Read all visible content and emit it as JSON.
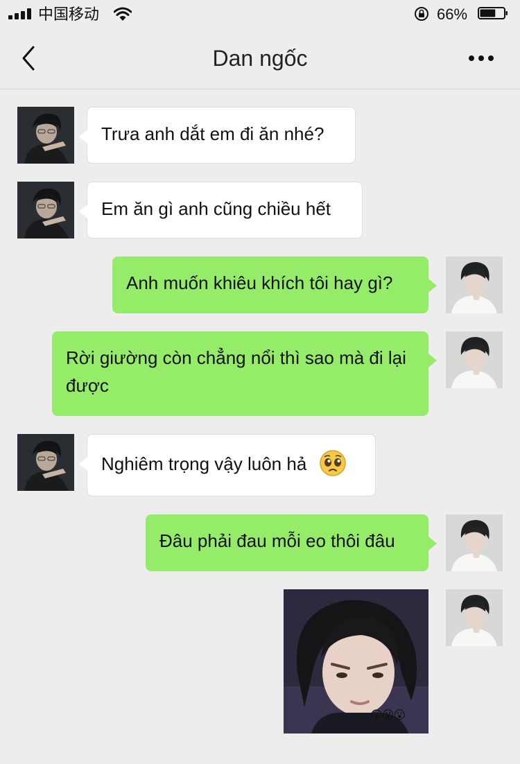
{
  "status_bar": {
    "carrier": "中国移动",
    "battery_percent": "66%",
    "battery_level": 0.66
  },
  "header": {
    "title": "Dan ngốc"
  },
  "messages": [
    {
      "from": "them",
      "text": "Trưa anh dắt em đi ăn nhé?"
    },
    {
      "from": "them",
      "text": "Em ăn gì anh cũng chiều hết"
    },
    {
      "from": "me",
      "text": "Anh muốn khiêu khích tôi hay gì?"
    },
    {
      "from": "me",
      "text": "Rời giường còn chẳng nổi thì sao mà đi lại được"
    },
    {
      "from": "them",
      "text": "Nghiêm trọng vậy luôn hả",
      "emoji": "pleading-face"
    },
    {
      "from": "me",
      "text": "Đâu phải đau mỗi eo thôi đâu"
    },
    {
      "from": "me",
      "type": "image",
      "emoji_overlay": [
        "😮",
        "😮",
        "😮"
      ]
    }
  ],
  "colors": {
    "background": "#ededed",
    "outgoing_bubble": "#95ec69",
    "incoming_bubble": "#ffffff"
  }
}
